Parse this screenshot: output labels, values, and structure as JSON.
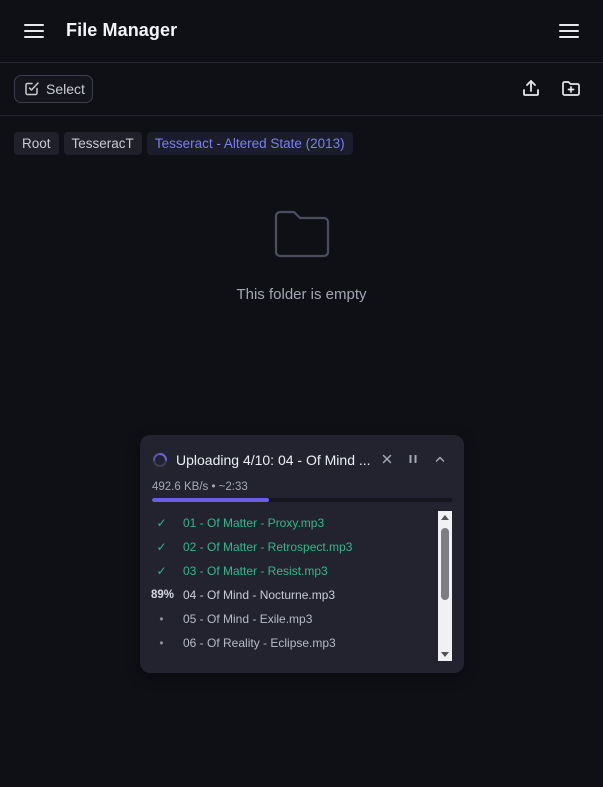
{
  "header": {
    "title": "File Manager",
    "left_icon": "menu-icon",
    "right_icon": "menu-icon"
  },
  "toolbar": {
    "select_label": "Select",
    "select_icon": "checkbox-edit-icon",
    "upload_icon": "upload-icon",
    "new_folder_icon": "folder-plus-icon"
  },
  "breadcrumb": [
    {
      "label": "Root"
    },
    {
      "label": "TesseracT"
    },
    {
      "label": "Tesseract - Altered State (2013)"
    }
  ],
  "empty_state": {
    "icon": "folder-icon",
    "text": "This folder is empty"
  },
  "upload": {
    "title": "Uploading 4/10: 04 - Of Mind ...",
    "speed": "492.6 KB/s • ~2:33",
    "progress": 0.39,
    "files": [
      {
        "status": "✓",
        "name": "01 - Of Matter - Proxy.mp3",
        "state": "done"
      },
      {
        "status": "✓",
        "name": "02 - Of Matter - Retrospect.mp3",
        "state": "done"
      },
      {
        "status": "✓",
        "name": "03 - Of Matter - Resist.mp3",
        "state": "done"
      },
      {
        "status": "89%",
        "name": "04 - Of Mind - Nocturne.mp3",
        "state": "active"
      },
      {
        "status": "•",
        "name": "05 - Of Mind - Exile.mp3",
        "state": "queued"
      },
      {
        "status": "•",
        "name": "06 - Of Reality - Eclipse.mp3",
        "state": "queued"
      }
    ]
  },
  "colors": {
    "accent": "#6a5fe6",
    "done": "#2fb98a",
    "background": "#0f1015",
    "panel": "#22232f"
  }
}
